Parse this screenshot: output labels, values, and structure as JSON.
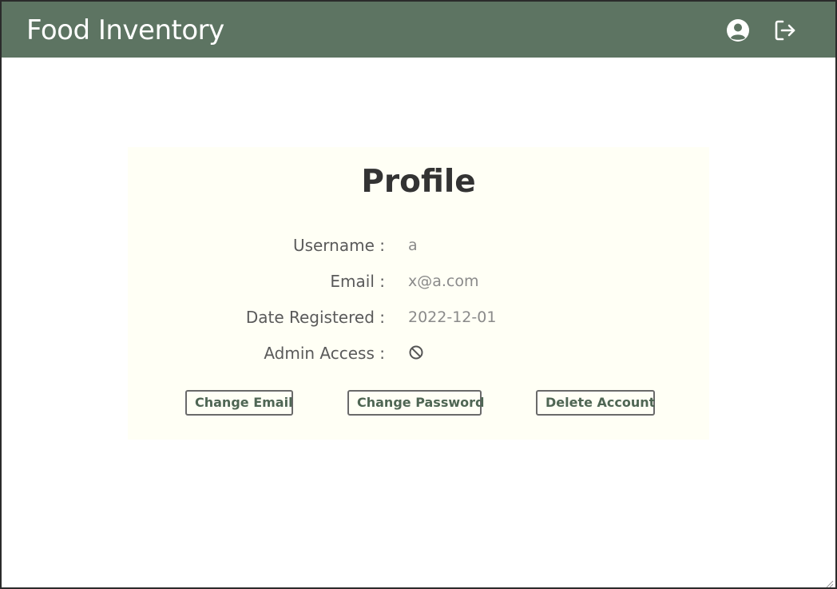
{
  "header": {
    "brand": "Food Inventory",
    "icons": {
      "profile": "user-circle-icon",
      "logout": "logout-icon"
    },
    "background_color": "#5d7462"
  },
  "profile": {
    "title": "Profile",
    "fields": [
      {
        "label": "Username :",
        "value": "a"
      },
      {
        "label": "Email :",
        "value": "x@a.com"
      },
      {
        "label": "Date Registered :",
        "value": "2022-12-01"
      },
      {
        "label": "Admin Access :",
        "value_icon": "ban-icon"
      }
    ],
    "buttons": {
      "change_email": "Change Email",
      "change_password": "Change Password",
      "delete_account": "Delete Account"
    }
  }
}
